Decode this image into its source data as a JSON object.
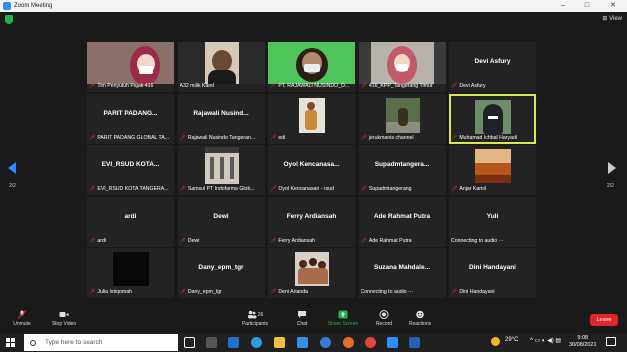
{
  "window": {
    "title": "Zoom Meeting",
    "view_label": "View",
    "min": "–",
    "max": "□",
    "close": "✕"
  },
  "pagination": {
    "left": "2/2",
    "right": "2/2"
  },
  "tiles": [
    {
      "name": "Tim Penyuluh Pajak 416",
      "big": "",
      "muted": true,
      "video": "video-hijab"
    },
    {
      "name": "A32 milik Karel",
      "big": "",
      "muted": false,
      "video": "video-man"
    },
    {
      "name": "PT. RAJAWALI NUSINDO_D...",
      "big": "",
      "muted": true,
      "video": "video-green"
    },
    {
      "name": "416_KPP_Tangerang Timur",
      "big": "",
      "muted": true,
      "video": "video-hijab2"
    },
    {
      "name": "Devi Asfury",
      "big": "Devi Asfury",
      "muted": true,
      "video": ""
    },
    {
      "name": "PARIT PADANG GLOBAL TA...",
      "big": "PARIT PADANG...",
      "muted": true,
      "video": ""
    },
    {
      "name": "Rajawali Nusindo Tangeran...",
      "big": "Rajawali  Nusind...",
      "muted": true,
      "video": ""
    },
    {
      "name": "edi",
      "big": "",
      "muted": true,
      "video": "video-dancer"
    },
    {
      "name": "jerukmanis channel",
      "big": "",
      "muted": true,
      "video": "video-outdoor"
    },
    {
      "name": "Muhamad Ichbal Haryadi",
      "big": "",
      "muted": true,
      "video": "video-hooded",
      "active": true
    },
    {
      "name": "EVI_RSUD KOTA TANGERA...",
      "big": "EVI_RSUD  KOTA...",
      "muted": true,
      "video": ""
    },
    {
      "name": "Samsul PT Indofarma Glob...",
      "big": "",
      "muted": true,
      "video": "video-building"
    },
    {
      "name": "Oyol Kencanasari - rsud",
      "big": "Oyol  Kencanasa...",
      "muted": true,
      "video": ""
    },
    {
      "name": "Supadmtangerang",
      "big": "Supadmtangera...",
      "muted": true,
      "video": ""
    },
    {
      "name": "Anjar Kamil",
      "big": "",
      "muted": true,
      "video": "video-desert"
    },
    {
      "name": "ardi",
      "big": "ardi",
      "muted": true,
      "video": ""
    },
    {
      "name": "Dewi",
      "big": "Dewi",
      "muted": true,
      "video": ""
    },
    {
      "name": "Ferry Ardiansah",
      "big": "Ferry Ardiansah",
      "muted": true,
      "video": ""
    },
    {
      "name": "Ade Rahmat Putra",
      "big": "Ade Rahmat Putra",
      "muted": true,
      "video": ""
    },
    {
      "name": "Connecting to audio ···",
      "big": "Yuli",
      "muted": false,
      "video": ""
    },
    {
      "name": "Julia Istiqomah",
      "big": "",
      "muted": true,
      "video": "video-dark"
    },
    {
      "name": "Dany_epm_tgr",
      "big": "Dany_epm_tgr",
      "muted": true,
      "video": ""
    },
    {
      "name": "Deni Arianda",
      "big": "",
      "muted": true,
      "video": "video-family"
    },
    {
      "name": "Connecting to audio ···",
      "big": "Suzana  Mahdale...",
      "muted": false,
      "video": ""
    },
    {
      "name": "Dini Handayani",
      "big": "Dini Handayani",
      "muted": true,
      "video": ""
    }
  ],
  "toolbar": {
    "unmute": "Unmute",
    "stop_video": "Stop Video",
    "participants": "Participants",
    "participants_count": "26",
    "chat": "Chat",
    "share_screen": "Share Screen",
    "record": "Record",
    "reactions": "Reactions",
    "leave": "Leave"
  },
  "taskbar": {
    "search_placeholder": "Type here to search",
    "temperature": "29°C",
    "time": "9:08",
    "date": "30/08/2021"
  },
  "colors": {
    "accent": "#2d8cff",
    "muted_mic": "#e8383d",
    "active_speaker": "#d9e84a",
    "share": "#23b14d",
    "leave": "#e02828"
  }
}
